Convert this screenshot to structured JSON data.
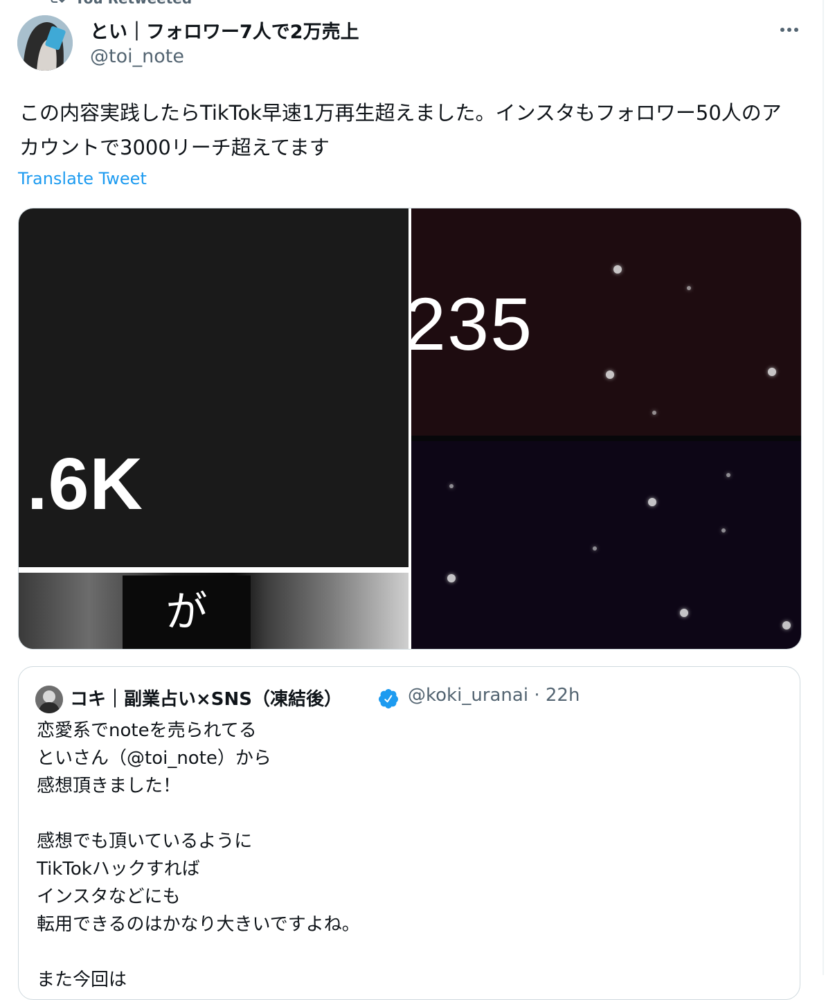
{
  "retweet": {
    "label": "You Retweeted"
  },
  "tweet": {
    "author_name": "とい｜フォロワー7人で2万売上",
    "author_handle": "@toi_note",
    "text": "この内容実践したらTikTok早速1万再生超えました。インスタもフォロワー50人のアカウントで3000リーチ超えてます",
    "translate_label": "Translate Tweet"
  },
  "media": {
    "left_stat": ".6K",
    "left_caption": "が",
    "right_stat": "235"
  },
  "quote": {
    "author_name": "コキ｜副業占い×SNS（凍結後）",
    "author_handle": "@koki_uranai",
    "separator": "·",
    "time": "22h",
    "lines": [
      "恋愛系でnoteを売られてる",
      "といさん（@toi_note）から",
      "感想頂きました！",
      "",
      "感想でも頂いているように",
      "TikTokハックすれば",
      "インスタなどにも",
      "転用できるのはかなり大きいですよね。",
      "",
      "また今回は"
    ]
  },
  "colors": {
    "link_blue": "#1d9bf0",
    "secondary_text": "#536471",
    "border": "#cfd9de",
    "verified": "#1d9bf0"
  },
  "icons": [
    "retweet-icon",
    "more-icon",
    "verified-badge-icon"
  ]
}
